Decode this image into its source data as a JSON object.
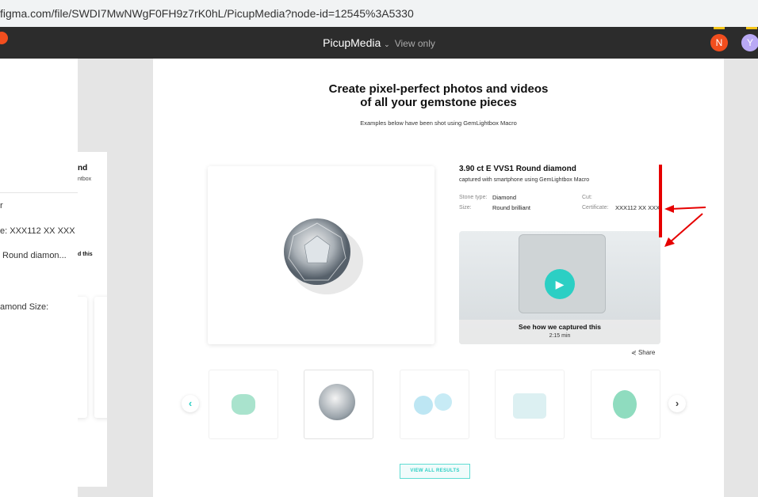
{
  "browser": {
    "url": "figma.com/file/SWDI7MwNWgF0FH9z7rK0hL/PicupMedia?node-id=12545%3A5330"
  },
  "toolbar": {
    "file_name": "PicupMedia",
    "mode": "View only",
    "avatars": [
      {
        "initial": "N",
        "color": "#f24e1e"
      },
      {
        "initial": "Y",
        "color": "#b9a9f5"
      }
    ]
  },
  "left_panel": {
    "lines": [
      "r",
      "e: XXX112 XX XXX",
      "Round diamon...",
      "amond Size:"
    ]
  },
  "frame2": {
    "title": "nd",
    "subtitle": "ntbox",
    "video": "d this"
  },
  "main": {
    "heading_line1": "Create pixel-perfect photos and videos",
    "heading_line2": "of all your gemstone pieces",
    "subheading": "Examples below have been shot using GemLightbox Macro",
    "product": {
      "title": "3.90 ct E VVS1 Round diamond",
      "subtitle": "captured with smartphone using GemLightbox Macro",
      "stone_type_label": "Stone type:",
      "stone_type": "Diamond",
      "size_label": "Size:",
      "size": "Round brilliant",
      "cut_label": "Cut:",
      "cut": "",
      "certificate_label": "Certificate:",
      "certificate": "XXX112 XX XXX"
    },
    "video": {
      "caption": "See how we captured this",
      "duration": "2:15 min"
    },
    "share_label": "Share",
    "thumbnails": [
      "green gemstone",
      "round diamond",
      "blue gemstones pair",
      "aquamarine cushion",
      "green round gemstone"
    ],
    "view_all": "VIEW ALL RESULTS"
  },
  "colors": {
    "accent": "#2ccfc4",
    "annotation": "#e60000"
  }
}
